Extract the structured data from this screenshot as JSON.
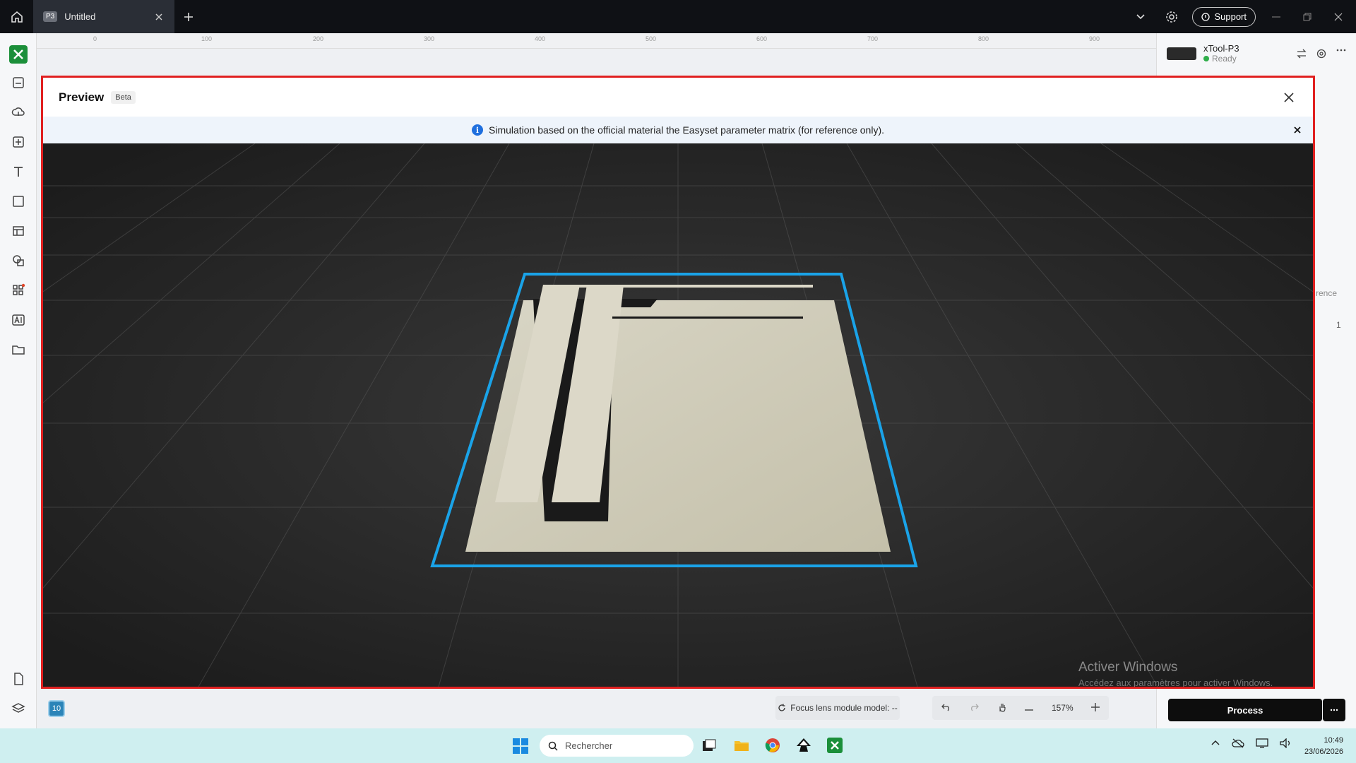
{
  "titlebar": {
    "tab_badge": "P3",
    "tab_title": "Untitled",
    "support_label": "Support"
  },
  "ruler": {
    "ticks": [
      "0",
      "100",
      "200",
      "300",
      "400",
      "500",
      "600",
      "700",
      "800",
      "900"
    ]
  },
  "device": {
    "name": "xTool-P3",
    "status": "Ready"
  },
  "panel_partial": {
    "reference": "rence",
    "count": "1"
  },
  "canvas_bar": {
    "layer_number": "10",
    "focus_label": "Focus lens module model: --",
    "zoom": "157%",
    "process_label": "Process"
  },
  "modal": {
    "title": "Preview",
    "badge": "Beta",
    "notice": "Simulation based on the official material the Easyset parameter matrix (for reference only).",
    "watermark_title": "Activer Windows",
    "watermark_sub": "Accédez aux paramètres pour activer Windows."
  },
  "taskbar": {
    "search_placeholder": "Rechercher",
    "time": "10:49",
    "date": "23/06/2026"
  },
  "colors": {
    "accent_red": "#e02020",
    "outline_blue": "#1aa3e8",
    "material": "#cbc7b2"
  }
}
